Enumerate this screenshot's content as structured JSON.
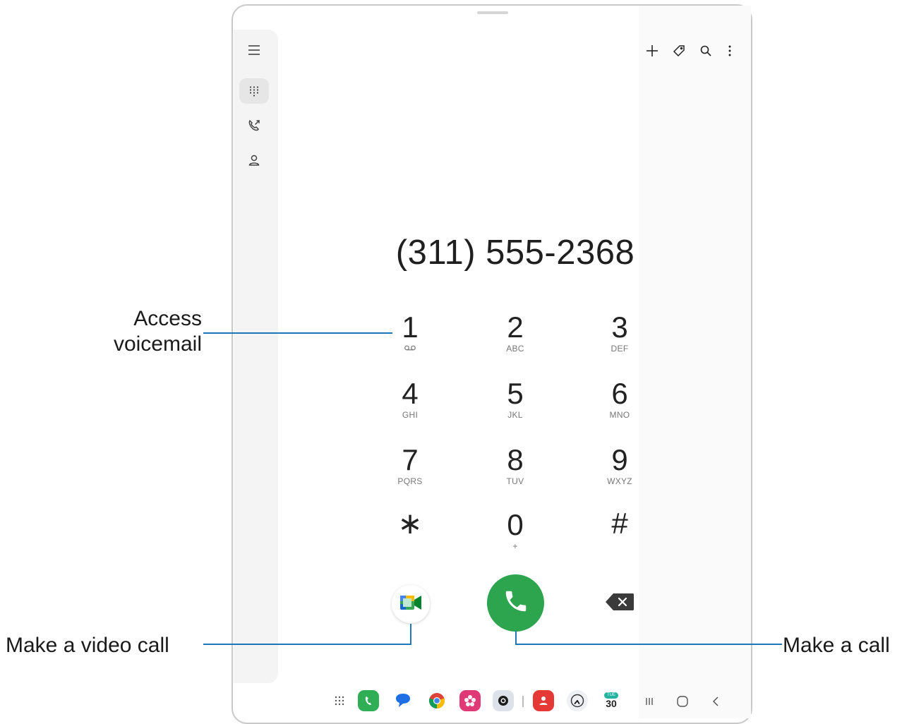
{
  "dialer": {
    "phone_number": "(311) 555-2368",
    "keys": [
      {
        "digit": "1",
        "letters": ""
      },
      {
        "digit": "2",
        "letters": "ABC"
      },
      {
        "digit": "3",
        "letters": "DEF"
      },
      {
        "digit": "4",
        "letters": "GHI"
      },
      {
        "digit": "5",
        "letters": "JKL"
      },
      {
        "digit": "6",
        "letters": "MNO"
      },
      {
        "digit": "7",
        "letters": "PQRS"
      },
      {
        "digit": "8",
        "letters": "TUV"
      },
      {
        "digit": "9",
        "letters": "WXYZ"
      },
      {
        "digit": "∗",
        "letters": ""
      },
      {
        "digit": "0",
        "letters": "+"
      },
      {
        "digit": "#",
        "letters": ""
      }
    ],
    "call_color": "#2da44e"
  },
  "rail": {
    "icons": [
      "menu-icon",
      "keypad-icon",
      "recents-icon",
      "contacts-icon"
    ]
  },
  "toolbar": {
    "icons": [
      "add-icon",
      "tag-icon",
      "search-icon",
      "more-options-icon"
    ]
  },
  "callouts": {
    "voicemail_line1": "Access",
    "voicemail_line2": "voicemail",
    "video_call": "Make a video call",
    "make_call": "Make a call",
    "line_color": "#1d76b8"
  },
  "taskbar": {
    "apps": [
      "apps-grid-icon",
      "phone-app-icon",
      "messages-app-icon",
      "chrome-app-icon",
      "gallery-app-icon",
      "camera-app-icon",
      "contacts-app-icon",
      "clock-app-icon",
      "calendar-app-icon"
    ],
    "calendar_day": "TUE",
    "calendar_date": "30",
    "nav": [
      "recents-nav-icon",
      "home-nav-icon",
      "back-nav-icon"
    ]
  }
}
